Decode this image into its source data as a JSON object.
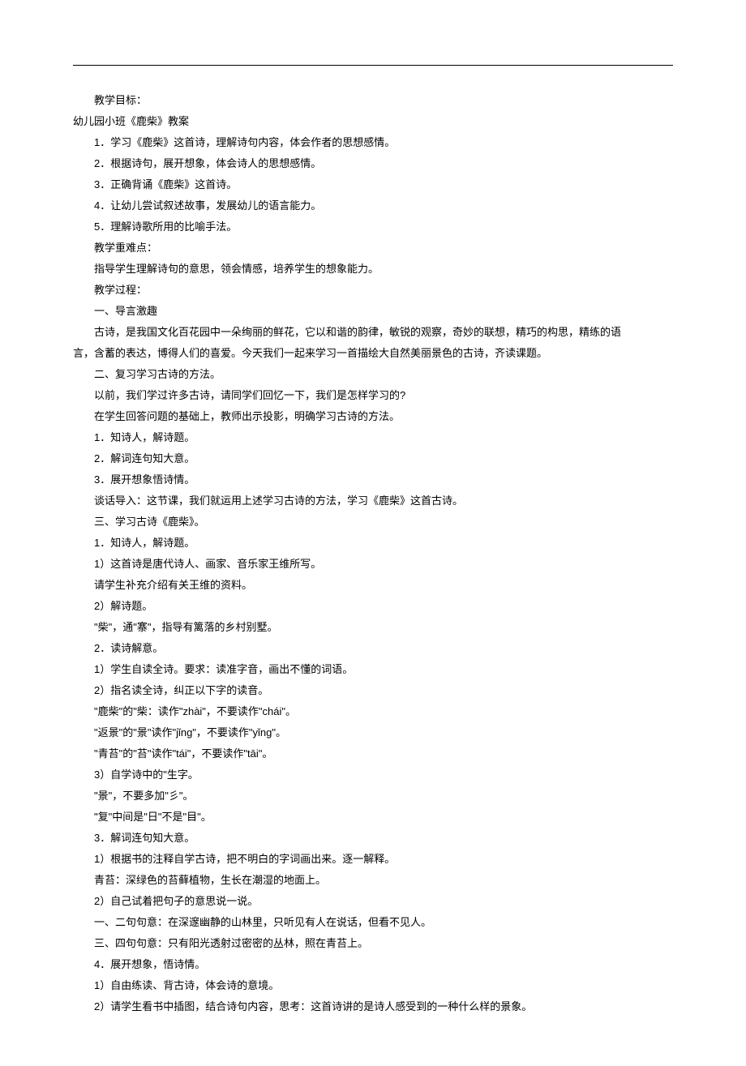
{
  "lines": [
    {
      "indent": 1,
      "text": "教学目标："
    },
    {
      "indent": 0,
      "text": "幼儿园小班《鹿柴》教案"
    },
    {
      "indent": 1,
      "text": "1．学习《鹿柴》这首诗，理解诗句内容，体会作者的思想感情。"
    },
    {
      "indent": 1,
      "text": "2．根据诗句，展开想象，体会诗人的思想感情。"
    },
    {
      "indent": 1,
      "text": "3．正确背诵《鹿柴》这首诗。"
    },
    {
      "indent": 1,
      "text": "4．让幼儿尝试叙述故事，发展幼儿的语言能力。"
    },
    {
      "indent": 1,
      "text": "5．理解诗歌所用的比喻手法。"
    },
    {
      "indent": 1,
      "text": "教学重难点："
    },
    {
      "indent": 1,
      "text": "指导学生理解诗句的意思，领会情感，培养学生的想象能力。"
    },
    {
      "indent": 1,
      "text": "教学过程："
    },
    {
      "indent": 1,
      "text": "一、导言激趣"
    },
    {
      "indent": 1,
      "text": "古诗，是我国文化百花园中一朵绚丽的鲜花，它以和谐的韵律，敏锐的观察，奇妙的联想，精巧的构思，精练的语"
    },
    {
      "indent": 0,
      "text": "言，含蓄的表达，博得人们的喜爱。今天我们一起来学习一首描绘大自然美丽景色的古诗，齐读课题。"
    },
    {
      "indent": 1,
      "text": "二、复习学习古诗的方法。"
    },
    {
      "indent": 1,
      "text": "以前，我们学过许多古诗，请同学们回忆一下，我们是怎样学习的?"
    },
    {
      "indent": 1,
      "text": "在学生回答问题的基础上，教师出示投影，明确学习古诗的方法。"
    },
    {
      "indent": 1,
      "text": "1．知诗人，解诗题。"
    },
    {
      "indent": 1,
      "text": "2．解词连句知大意。"
    },
    {
      "indent": 1,
      "text": "3．展开想象悟诗情。"
    },
    {
      "indent": 1,
      "text": "谈话导入：这节课，我们就运用上述学习古诗的方法，学习《鹿柴》这首古诗。"
    },
    {
      "indent": 1,
      "text": "三、学习古诗《鹿柴》。"
    },
    {
      "indent": 1,
      "text": "1．知诗人，解诗题。"
    },
    {
      "indent": 1,
      "text": "1）这首诗是唐代诗人、画家、音乐家王维所写。"
    },
    {
      "indent": 1,
      "text": "请学生补充介绍有关王维的资料。"
    },
    {
      "indent": 1,
      "text": "2）解诗题。"
    },
    {
      "indent": 1,
      "text": "\"柴\"，通\"寨\"，指导有篱落的乡村别墅。"
    },
    {
      "indent": 1,
      "text": "2．读诗解意。"
    },
    {
      "indent": 1,
      "text": "1）学生自读全诗。要求：读准字音，画出不懂的词语。"
    },
    {
      "indent": 1,
      "text": "2）指名读全诗，纠正以下字的读音。"
    },
    {
      "indent": 1,
      "text": "\"鹿柴\"的\"柴：读作\"zhài\"，不要读作\"chái\"。"
    },
    {
      "indent": 1,
      "text": "\"返景\"的\"景\"读作\"jǐng\"，不要读作\"yǐng\"。"
    },
    {
      "indent": 1,
      "text": "\"青苔\"的\"苔\"读作\"tái\"，不要读作\"tāi\"。"
    },
    {
      "indent": 1,
      "text": "3）自学诗中的\"生字。"
    },
    {
      "indent": 1,
      "text": "\"景\"，不要多加\"彡\"。"
    },
    {
      "indent": 1,
      "text": "\"复\"中间是\"日\"不是\"目\"。"
    },
    {
      "indent": 1,
      "text": "3．解词连句知大意。"
    },
    {
      "indent": 1,
      "text": "1）根据书的注释自学古诗，把不明白的字词画出来。逐一解释。"
    },
    {
      "indent": 1,
      "text": "青苔：深绿色的苔藓植物，生长在潮湿的地面上。"
    },
    {
      "indent": 1,
      "text": "2）自己试着把句子的意思说一说。"
    },
    {
      "indent": 1,
      "text": "一、二句句意：在深邃幽静的山林里，只听见有人在说话，但看不见人。"
    },
    {
      "indent": 1,
      "text": "三、四句句意：只有阳光透射过密密的丛林，照在青苔上。"
    },
    {
      "indent": 1,
      "text": "4．展开想象，悟诗情。"
    },
    {
      "indent": 1,
      "text": "1）自由练读、背古诗，体会诗的意境。"
    },
    {
      "indent": 1,
      "text": "2）请学生看书中插图，结合诗句内容，思考：这首诗讲的是诗人感受到的一种什么样的景象。"
    }
  ]
}
